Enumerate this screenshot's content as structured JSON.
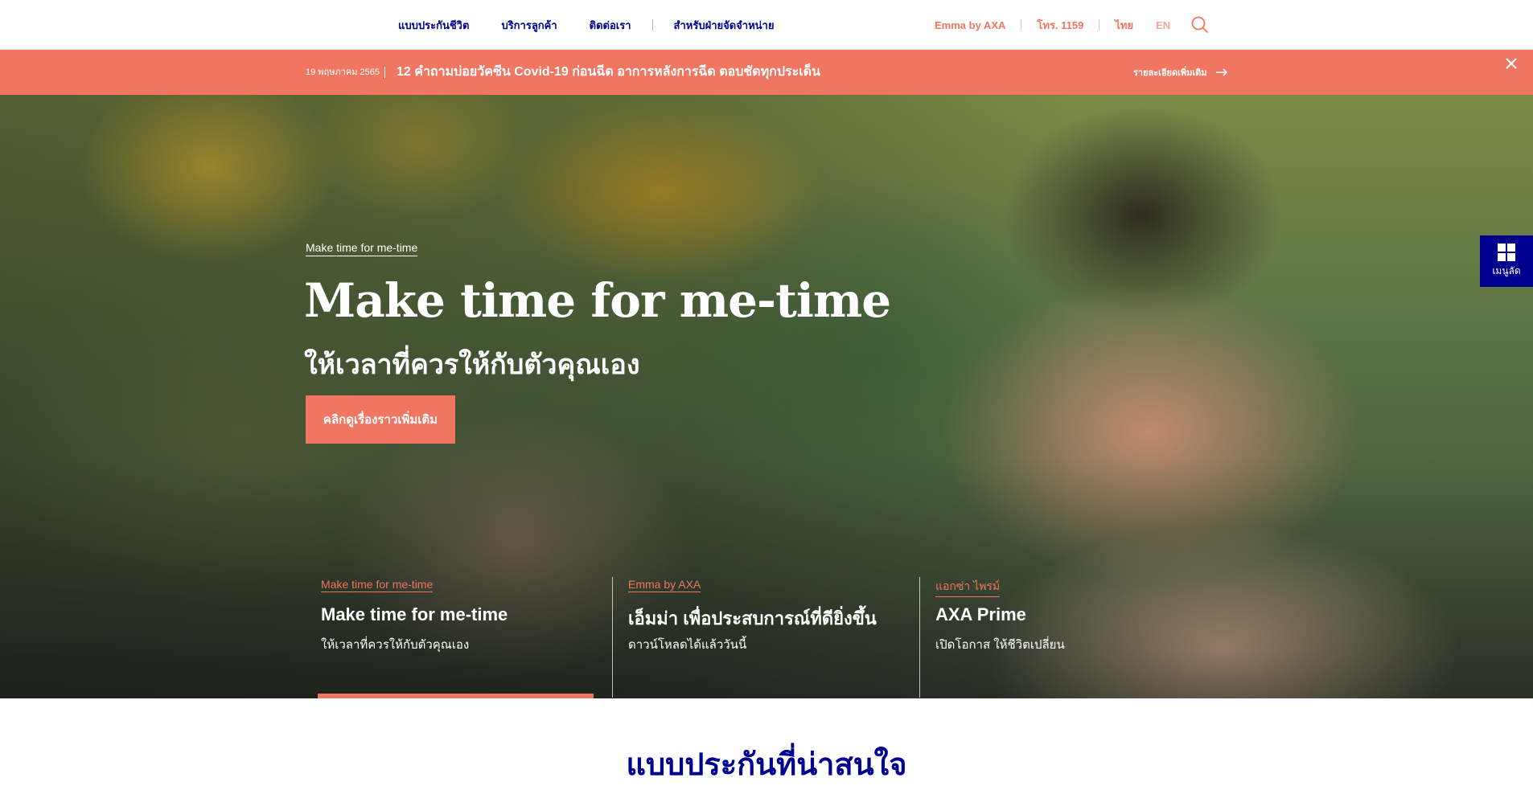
{
  "nav": {
    "links": [
      "แบบประกันชีวิต",
      "บริการลูกค้า",
      "ติดต่อเรา",
      "สำหรับฝ่ายจัดจำหน่าย"
    ],
    "emma": "Emma by AXA",
    "phone": "โทร. 1159",
    "lang_th": "ไทย",
    "lang_en": "EN",
    "search_icon": "search-icon"
  },
  "alert": {
    "date": "19 พฤษภาคม 2565",
    "text": "12 คำถามบ่อยวัคซีน Covid-19 ก่อนฉีด อาการหลังการฉีด ตอบชัดทุกประเด็น",
    "more": "รายละเอียดเพิ่มเติม",
    "close_icon": "close-icon"
  },
  "hero": {
    "eyebrow": "Make time for me-time",
    "title": "Make time for me-time",
    "subtitle": "ให้เวลาที่ควรให้กับตัวคุณเอง",
    "cta": "คลิกดูเรื่องราวเพิ่มเติม"
  },
  "slides": [
    {
      "eyebrow": "Make time for me-time",
      "title": "Make time for me-time",
      "desc": "ให้เวลาที่ควรให้กับตัวคุณเอง"
    },
    {
      "eyebrow": "Emma by AXA",
      "title": "เอ็มม่า เพื่อประสบการณ์ที่ดียิ่งขึ้น",
      "desc": "ดาวน์โหลดได้แล้ววันนี้"
    },
    {
      "eyebrow": "แอกซ่า ไพรม์",
      "title": "AXA Prime",
      "desc": "เปิดโอกาส ให้ชีวิตเปลี่ยน"
    }
  ],
  "quick_menu": {
    "label": "เมนูลัด",
    "icon": "grid-icon"
  },
  "section": {
    "title": "แบบประกันที่น่าสนใจ"
  },
  "colors": {
    "brand_blue": "#00008f",
    "accent": "#f07662"
  }
}
